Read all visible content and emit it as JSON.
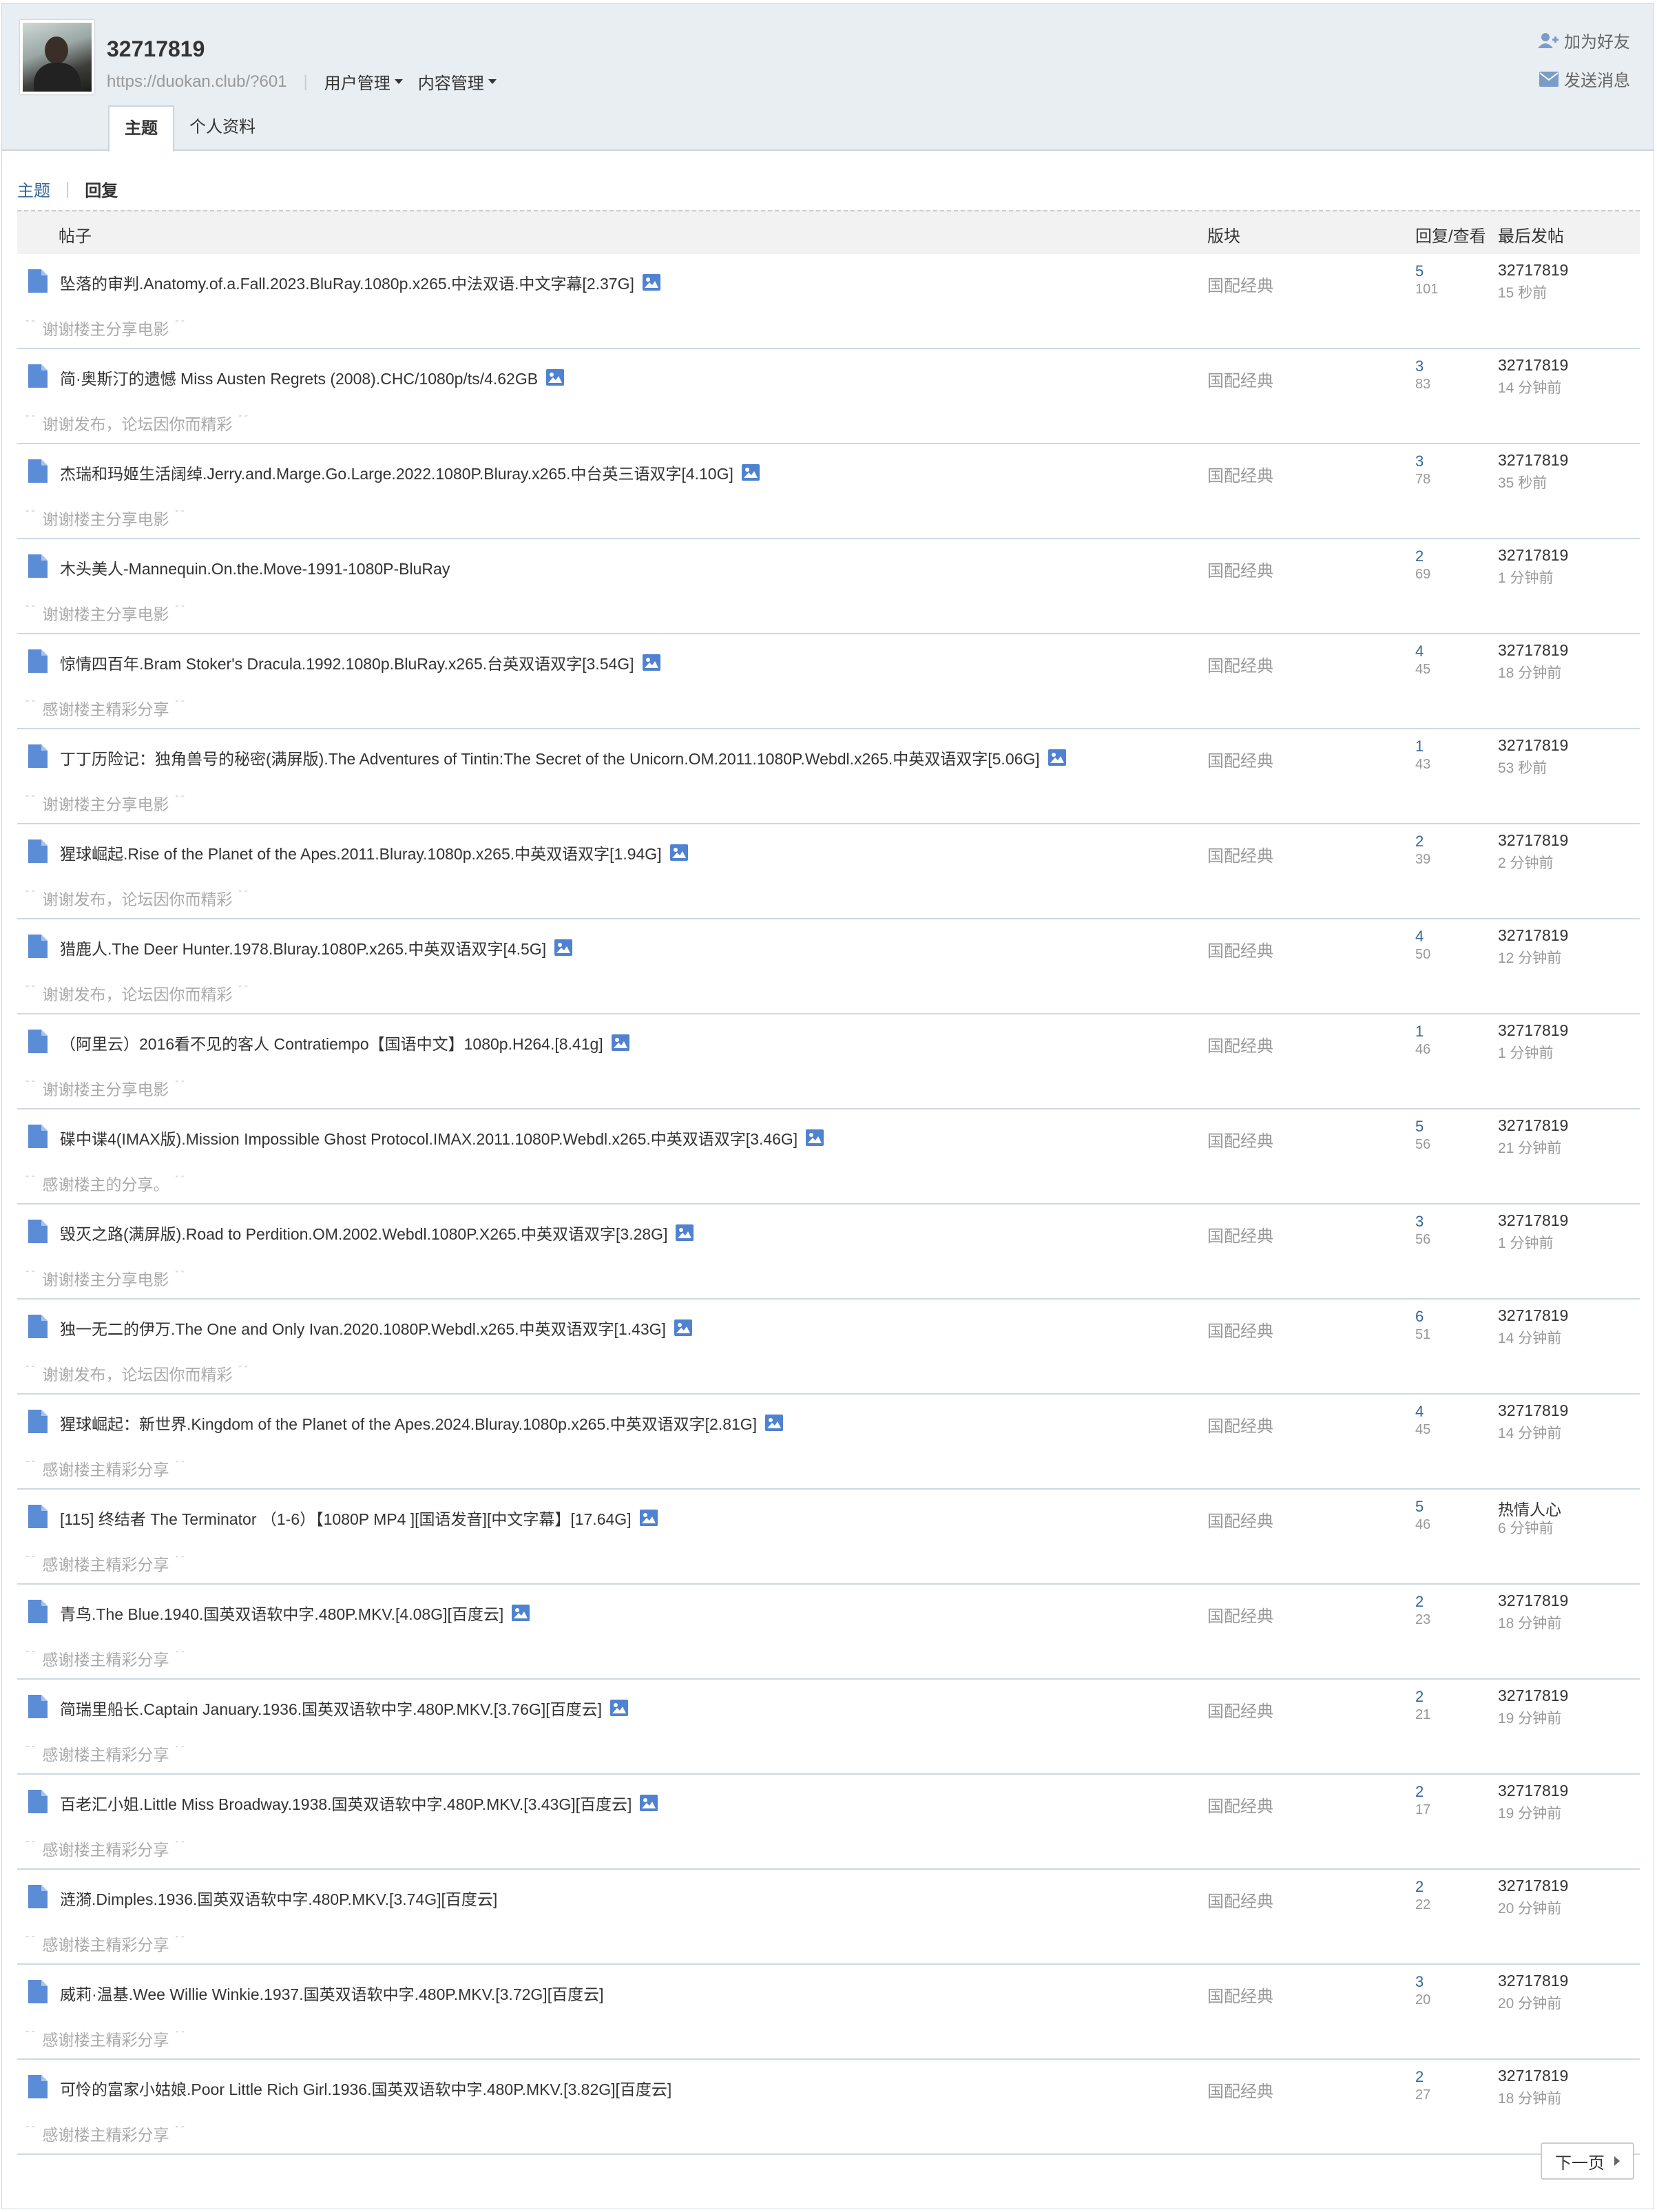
{
  "profile": {
    "username": "32717819",
    "url": "https://duokan.club/?601",
    "menus": [
      "用户管理",
      "内容管理"
    ],
    "add_friend": "加为好友",
    "send_message": "发送消息"
  },
  "tabs": [
    "主题",
    "个人资料"
  ],
  "subnav": {
    "threads": "主题",
    "replies": "回复"
  },
  "columns": {
    "post": "帖子",
    "forum": "版块",
    "replies_views": "回复/查看",
    "last_post": "最后发帖"
  },
  "colors": {
    "link": "#336699",
    "header_bg": "#e8eef2",
    "icon": "#5b8cd6"
  },
  "rows": [
    {
      "title": "坠落的审判.Anatomy.of.a.Fall.2023.BluRay.1080p.x265.中法双语.中文字幕[2.37G]",
      "has_image": true,
      "forum": "国配经典",
      "replies": "5",
      "views": "101",
      "last_user": "32717819",
      "last_time": "15 秒前",
      "quote": "谢谢楼主分享电影"
    },
    {
      "title": "简·奥斯汀的遗憾 Miss Austen Regrets (2008).CHC/1080p/ts/4.62GB",
      "has_image": true,
      "forum": "国配经典",
      "replies": "3",
      "views": "83",
      "last_user": "32717819",
      "last_time": "14 分钟前",
      "quote": "谢谢发布，论坛因你而精彩"
    },
    {
      "title": "杰瑞和玛姬生活阔绰.Jerry.and.Marge.Go.Large.2022.1080P.Bluray.x265.中台英三语双字[4.10G]",
      "has_image": true,
      "forum": "国配经典",
      "replies": "3",
      "views": "78",
      "last_user": "32717819",
      "last_time": "35 秒前",
      "quote": "谢谢楼主分享电影"
    },
    {
      "title": "木头美人-Mannequin.On.the.Move-1991-1080P-BluRay",
      "has_image": false,
      "forum": "国配经典",
      "replies": "2",
      "views": "69",
      "last_user": "32717819",
      "last_time": "1 分钟前",
      "quote": "谢谢楼主分享电影"
    },
    {
      "title": "惊情四百年.Bram Stoker's Dracula.1992.1080p.BluRay.x265.台英双语双字[3.54G]",
      "has_image": true,
      "forum": "国配经典",
      "replies": "4",
      "views": "45",
      "last_user": "32717819",
      "last_time": "18 分钟前",
      "quote": "感谢楼主精彩分享"
    },
    {
      "title": "丁丁历险记：独角兽号的秘密(满屏版).The Adventures of Tintin:The Secret of the Unicorn.OM.2011.1080P.Webdl.x265.中英双语双字[5.06G]",
      "has_image": true,
      "forum": "国配经典",
      "replies": "1",
      "views": "43",
      "last_user": "32717819",
      "last_time": "53 秒前",
      "quote": "谢谢楼主分享电影"
    },
    {
      "title": "猩球崛起.Rise of the Planet of the Apes.2011.Bluray.1080p.x265.中英双语双字[1.94G]",
      "has_image": true,
      "forum": "国配经典",
      "replies": "2",
      "views": "39",
      "last_user": "32717819",
      "last_time": "2 分钟前",
      "quote": "谢谢发布，论坛因你而精彩"
    },
    {
      "title": "猎鹿人.The Deer Hunter.1978.Bluray.1080P.x265.中英双语双字[4.5G]",
      "has_image": true,
      "forum": "国配经典",
      "replies": "4",
      "views": "50",
      "last_user": "32717819",
      "last_time": "12 分钟前",
      "quote": "谢谢发布，论坛因你而精彩"
    },
    {
      "title": "（阿里云）2016看不见的客人 Contratiempo【国语中文】1080p.H264.[8.41g]",
      "has_image": true,
      "forum": "国配经典",
      "replies": "1",
      "views": "46",
      "last_user": "32717819",
      "last_time": "1 分钟前",
      "quote": "谢谢楼主分享电影"
    },
    {
      "title": "碟中谍4(IMAX版).Mission Impossible Ghost Protocol.IMAX.2011.1080P.Webdl.x265.中英双语双字[3.46G]",
      "has_image": true,
      "forum": "国配经典",
      "replies": "5",
      "views": "56",
      "last_user": "32717819",
      "last_time": "21 分钟前",
      "quote": "感谢楼主的分享。"
    },
    {
      "title": "毁灭之路(满屏版).Road to Perdition.OM.2002.Webdl.1080P.X265.中英双语双字[3.28G]",
      "has_image": true,
      "forum": "国配经典",
      "replies": "3",
      "views": "56",
      "last_user": "32717819",
      "last_time": "1 分钟前",
      "quote": "谢谢楼主分享电影"
    },
    {
      "title": "独一无二的伊万.The One and Only Ivan.2020.1080P.Webdl.x265.中英双语双字[1.43G]",
      "has_image": true,
      "forum": "国配经典",
      "replies": "6",
      "views": "51",
      "last_user": "32717819",
      "last_time": "14 分钟前",
      "quote": "谢谢发布，论坛因你而精彩"
    },
    {
      "title": "猩球崛起：新世界.Kingdom of the Planet of the Apes.2024.Bluray.1080p.x265.中英双语双字[2.81G]",
      "has_image": true,
      "forum": "国配经典",
      "replies": "4",
      "views": "45",
      "last_user": "32717819",
      "last_time": "14 分钟前",
      "quote": "感谢楼主精彩分享"
    },
    {
      "title": "[115] 终结者 The Terminator （1-6）【1080P MP4 ][国语发音][中文字幕】[17.64G]",
      "has_image": true,
      "forum": "国配经典",
      "replies": "5",
      "views": "46",
      "last_user": "热情人心",
      "last_time": "6 分钟前",
      "quote": "感谢楼主精彩分享"
    },
    {
      "title": "青鸟.The Blue.1940.国英双语软中字.480P.MKV.[4.08G][百度云]",
      "has_image": true,
      "forum": "国配经典",
      "replies": "2",
      "views": "23",
      "last_user": "32717819",
      "last_time": "18 分钟前",
      "quote": "感谢楼主精彩分享"
    },
    {
      "title": "简瑞里船长.Captain January.1936.国英双语软中字.480P.MKV.[3.76G][百度云]",
      "has_image": true,
      "forum": "国配经典",
      "replies": "2",
      "views": "21",
      "last_user": "32717819",
      "last_time": "19 分钟前",
      "quote": "感谢楼主精彩分享"
    },
    {
      "title": "百老汇小姐.Little Miss Broadway.1938.国英双语软中字.480P.MKV.[3.43G][百度云]",
      "has_image": true,
      "forum": "国配经典",
      "replies": "2",
      "views": "17",
      "last_user": "32717819",
      "last_time": "19 分钟前",
      "quote": "感谢楼主精彩分享"
    },
    {
      "title": "涟漪.Dimples.1936.国英双语软中字.480P.MKV.[3.74G][百度云]",
      "has_image": false,
      "forum": "国配经典",
      "replies": "2",
      "views": "22",
      "last_user": "32717819",
      "last_time": "20 分钟前",
      "quote": "感谢楼主精彩分享"
    },
    {
      "title": "威莉·温基.Wee Willie Winkie.1937.国英双语软中字.480P.MKV.[3.72G][百度云]",
      "has_image": false,
      "forum": "国配经典",
      "replies": "3",
      "views": "20",
      "last_user": "32717819",
      "last_time": "20 分钟前",
      "quote": "感谢楼主精彩分享"
    },
    {
      "title": "可怜的富家小姑娘.Poor Little Rich Girl.1936.国英双语软中字.480P.MKV.[3.82G][百度云]",
      "has_image": false,
      "forum": "国配经典",
      "replies": "2",
      "views": "27",
      "last_user": "32717819",
      "last_time": "18 分钟前",
      "quote": "感谢楼主精彩分享"
    }
  ],
  "pagination": {
    "next": "下一页"
  }
}
